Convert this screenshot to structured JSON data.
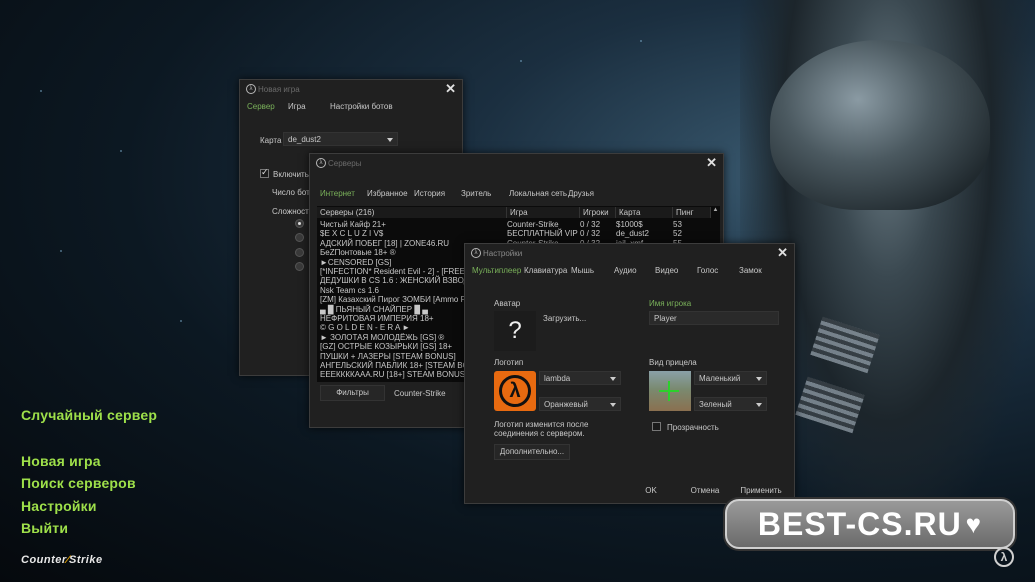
{
  "background": {
    "accent": "#9ee04a"
  },
  "main_menu": {
    "random_server": "Случайный сервер",
    "new_game": "Новая игра",
    "find_servers": "Поиск серверов",
    "settings": "Настройки",
    "exit": "Выйти"
  },
  "logo": {
    "left": "Counter",
    "right": "Strike"
  },
  "badge": {
    "text": "BEST-CS.RU",
    "heart": "♥"
  },
  "newgame": {
    "title": "Новая игра",
    "tabs": [
      "Сервер",
      "Игра",
      "Настройки ботов"
    ],
    "map_label": "Карта",
    "map_value": "de_dust2",
    "bots_checkbox": "Включить б",
    "bots_count_label": "Число ботов",
    "difficulty_label": "Сложность"
  },
  "servers": {
    "title": "Серверы",
    "tabs": [
      "Интернет",
      "Избранное",
      "История",
      "Зритель",
      "Локальная сеть",
      "Друзья"
    ],
    "columns": [
      "Серверы (216)",
      "Игра",
      "Игроки",
      "Карта",
      "Пинг"
    ],
    "rows": [
      {
        "name": "Чистый Кайф 21+",
        "game": "Counter-Strike",
        "players": "0 / 32",
        "map": "$1000$",
        "ping": "53"
      },
      {
        "name": "$E X C L U Z I V$",
        "game": "БЕСПЛАТНЫЙ VIP",
        "players": "0 / 32",
        "map": "de_dust2",
        "ping": "52"
      },
      {
        "name": "АДСКИЙ ПОБЕГ [18] | ZONE46.RU",
        "game": "Counter-Strike",
        "players": "0 / 32",
        "map": "jail_xmf",
        "ping": "55"
      },
      {
        "name": "БеZПонтовые 18+ ®",
        "game": "",
        "players": "",
        "map": "",
        "ping": ""
      },
      {
        "name": "►CENSORED [GS]",
        "game": "",
        "players": "",
        "map": "",
        "ping": ""
      },
      {
        "name": "[*INFECTION* Resident Evil - 2] - [FREE VIP+XP]",
        "game": "",
        "players": "",
        "map": "",
        "ping": ""
      },
      {
        "name": "ДЕДУШКИ В CS 1.6 : ЖЕНСКИЙ ВЗВОД @™",
        "game": "",
        "players": "",
        "map": "",
        "ping": ""
      },
      {
        "name": "Nsk Team cs 1.6",
        "game": "",
        "players": "",
        "map": "",
        "ping": ""
      },
      {
        "name": "[ZM] Казахский Пирог ЗОМБИ [Ammo Pack]",
        "game": "",
        "players": "",
        "map": "",
        "ping": ""
      },
      {
        "name": "▄ █ ПЬЯНЫЙ СНАЙПЕР █ ▄",
        "game": "",
        "players": "",
        "map": "",
        "ping": ""
      },
      {
        "name": "НЕФРИТОВАЯ ИМПЕРИЯ 18+",
        "game": "",
        "players": "",
        "map": "",
        "ping": ""
      },
      {
        "name": "© G O L D E N - E R A ►",
        "game": "",
        "players": "",
        "map": "",
        "ping": ""
      },
      {
        "name": "► ЗОЛОТАЯ МОЛОДЁЖЬ [GS] ®",
        "game": "",
        "players": "",
        "map": "",
        "ping": ""
      },
      {
        "name": "[GZ] ОСТРЫЕ КОЗЫРЬКИ [GS] 18+",
        "game": "",
        "players": "",
        "map": "",
        "ping": ""
      },
      {
        "name": "ПУШКИ + ЛАЗЕРЫ [STEAM BONUS]",
        "game": "",
        "players": "",
        "map": "",
        "ping": ""
      },
      {
        "name": "АНГЕЛЬСКИЙ ПАБЛИК 18+ [STEAM BONUS]",
        "game": "",
        "players": "",
        "map": "",
        "ping": ""
      },
      {
        "name": "ЕЕЕККККААА.RU [18+] STEAM BONUS",
        "game": "",
        "players": "",
        "map": "",
        "ping": ""
      }
    ],
    "filters_button": "Фильтры",
    "game_filter": "Counter-Strike"
  },
  "settings": {
    "title": "Настройки",
    "tabs": [
      "Мультиплеер",
      "Клавиатура",
      "Мышь",
      "Аудио",
      "Видео",
      "Голос",
      "Замок"
    ],
    "avatar_label": "Аватар",
    "avatar_placeholder": "?",
    "upload_button": "Загрузить...",
    "player_name_label": "Имя игрока",
    "player_name_value": "Player",
    "logo_label": "Логотип",
    "logo_value": "lambda",
    "logo_color": "Оранжевый",
    "logo_note": "Логотип изменится после соединения с сервером.",
    "advanced_button": "Дополнительно...",
    "crosshair_label": "Вид прицела",
    "crosshair_size": "Маленький",
    "crosshair_color": "Зеленый",
    "transparency_label": "Прозрачность",
    "ok_button": "OK",
    "cancel_button": "Отмена",
    "apply_button": "Применить"
  }
}
